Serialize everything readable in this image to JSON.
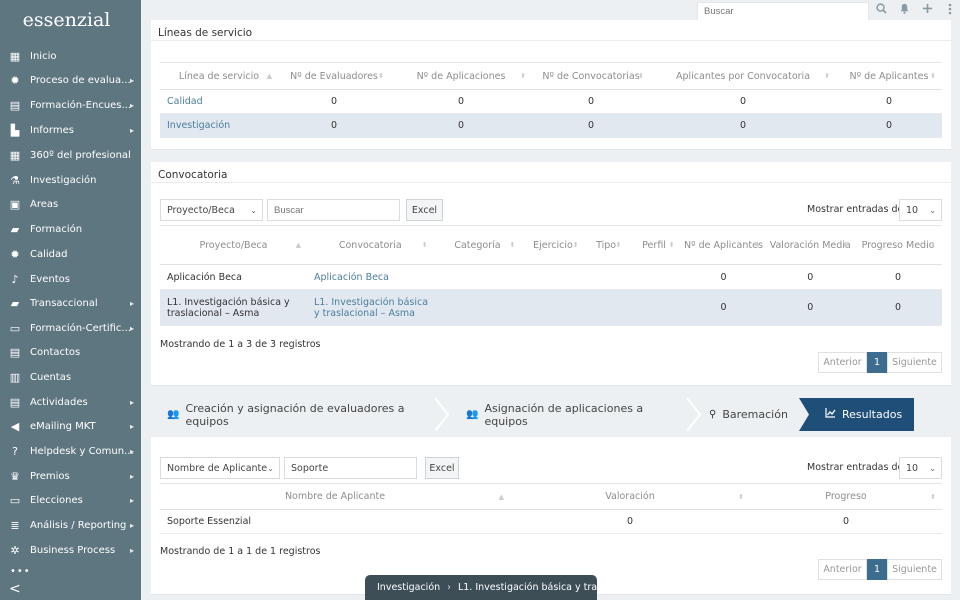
{
  "app": {
    "logo": "essenzial"
  },
  "topbar": {
    "search_placeholder": "Buscar",
    "icons": [
      "search-icon",
      "bell-icon",
      "plus-icon",
      "more-vertical-icon"
    ]
  },
  "sidebar": {
    "items": [
      {
        "label": "Inicio",
        "icon": "grid-icon",
        "arrow": false
      },
      {
        "label": "Proceso de evalua...",
        "icon": "gear-icon",
        "arrow": true
      },
      {
        "label": "Formación-Encues...",
        "icon": "clipboard-icon",
        "arrow": true
      },
      {
        "label": "Informes",
        "icon": "bar-chart-icon",
        "arrow": true
      },
      {
        "label": "360º del profesional",
        "icon": "calendar-icon",
        "arrow": false
      },
      {
        "label": "Investigación",
        "icon": "flask-icon",
        "arrow": false
      },
      {
        "label": "Áreas",
        "icon": "image-icon",
        "arrow": false
      },
      {
        "label": "Formación",
        "icon": "graduation-cap-icon",
        "arrow": false
      },
      {
        "label": "Calidad",
        "icon": "gear-icon",
        "arrow": false
      },
      {
        "label": "Eventos",
        "icon": "microphone-icon",
        "arrow": false
      },
      {
        "label": "Transaccional",
        "icon": "graduation-cap-icon",
        "arrow": true
      },
      {
        "label": "Formación-Certific...",
        "icon": "presentation-icon",
        "arrow": true
      },
      {
        "label": "Contactos",
        "icon": "address-book-icon",
        "arrow": false
      },
      {
        "label": "Cuentas",
        "icon": "building-icon",
        "arrow": false
      },
      {
        "label": "Actividades",
        "icon": "calendar-check-icon",
        "arrow": true
      },
      {
        "label": "eMailing MKT",
        "icon": "volume-icon",
        "arrow": true
      },
      {
        "label": "Helpdesk y Comun...",
        "icon": "question-icon",
        "arrow": true
      },
      {
        "label": "Premios",
        "icon": "trophy-icon",
        "arrow": true
      },
      {
        "label": "Elecciones",
        "icon": "laptop-icon",
        "arrow": true
      },
      {
        "label": "Análisis / Reporting",
        "icon": "database-icon",
        "arrow": true
      },
      {
        "label": "Business Process",
        "icon": "cogs-icon",
        "arrow": true
      }
    ],
    "more": "•••",
    "collapse": "<"
  },
  "lineas": {
    "title": "Líneas de servicio",
    "headers": [
      "Línea de servicio",
      "Nº de Evaluadores",
      "Nº de Aplicaciones",
      "Nº de Convocatorias",
      "Aplicantes por Convocatoria",
      "Nº de Aplicantes"
    ],
    "rows": [
      [
        "Calidad",
        "0",
        "0",
        "0",
        "0",
        "0"
      ],
      [
        "Investigación",
        "0",
        "0",
        "0",
        "0",
        "0"
      ]
    ]
  },
  "convocatoria": {
    "title": "Convocatoria",
    "filter_select": "Proyecto/Beca",
    "search_placeholder": "Buscar",
    "excel_label": "Excel",
    "show_entries_label": "Mostrar entradas de",
    "entries_value": "10",
    "headers": [
      "Proyecto/Beca",
      "Convocatoria",
      "Categoría",
      "Ejercicio",
      "Tipo",
      "Perfil",
      "Nº de Aplicantes",
      "Valoración Media",
      "Progreso Medio"
    ],
    "rows": [
      [
        "Aplicación Beca",
        "Aplicación Beca",
        "",
        "",
        "",
        "",
        "0",
        "0",
        "0"
      ],
      [
        "L1. Investigación básica y traslacional – Asma",
        "L1. Investigación básica y traslacional – Asma",
        "",
        "",
        "",
        "",
        "0",
        "0",
        "0"
      ]
    ],
    "info": "Mostrando de 1 a 3 de 3 registros",
    "pager": {
      "prev": "Anterior",
      "page": "1",
      "next": "Siguiente"
    }
  },
  "wizard": {
    "tabs": [
      {
        "label": "Creación y asignación de evaluadores a equipos",
        "icon": "users-icon",
        "active": false
      },
      {
        "label": "Asignación de aplicaciones a equipos",
        "icon": "users-icon",
        "active": false
      },
      {
        "label": "Baremación",
        "icon": "award-icon",
        "active": false
      },
      {
        "label": "Resultados",
        "icon": "line-chart-icon",
        "active": true
      }
    ]
  },
  "resultados": {
    "filter_select": "Nombre de Aplicante",
    "search_value": "Soporte",
    "excel_label": "Excel",
    "show_entries_label": "Mostrar entradas de",
    "entries_value": "10",
    "headers": [
      "Nombre de Aplicante",
      "Valoración",
      "Progreso"
    ],
    "rows": [
      [
        "Soporte Essenzial",
        "0",
        "0"
      ]
    ],
    "info": "Mostrando de 1 a 1 de 1 registros",
    "pager": {
      "prev": "Anterior",
      "page": "1",
      "next": "Siguiente"
    }
  },
  "breadcrumb": {
    "items": [
      "Investigación",
      "L1. Investigación básica y tra..."
    ],
    "separator": "›"
  },
  "colors": {
    "sidebar": "#5e7680",
    "accent": "#1f4e79",
    "link": "#4b7e9c",
    "row_alt": "#e2e8f0",
    "breadcrumb_bg": "#3d4e57"
  }
}
